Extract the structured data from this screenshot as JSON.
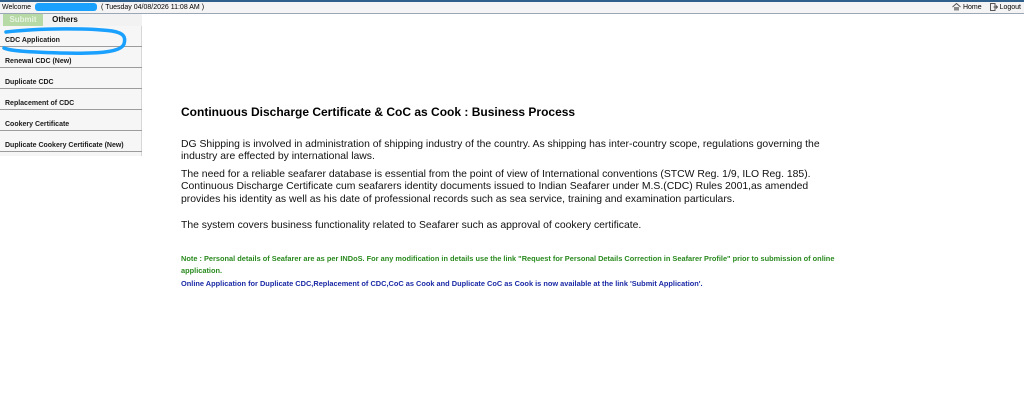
{
  "topbar": {
    "welcome_label": "Welcome",
    "datetime": "( Tuesday 04/08/2026 11:08 AM )",
    "home_label": "Home",
    "logout_label": "Logout"
  },
  "tabs": [
    {
      "label": "Submit",
      "active": true
    },
    {
      "label": "Others",
      "active": false
    }
  ],
  "sidebar": {
    "items": [
      {
        "label": "CDC Application"
      },
      {
        "label": "Renewal CDC (New)"
      },
      {
        "label": "Duplicate CDC"
      },
      {
        "label": "Replacement of CDC"
      },
      {
        "label": "Cookery Certificate"
      },
      {
        "label": "Duplicate Cookery Certificate (New)"
      }
    ]
  },
  "main": {
    "title": "Continuous Discharge Certificate & CoC as Cook : Business Process",
    "paragraphs": [
      "DG Shipping is involved in administration of shipping industry of the country. As shipping has inter-country scope, regulations governing the industry are effected by international laws.",
      "The need for a reliable seafarer database is essential from the point of view of International conventions (STCW Reg. 1/9, ILO Reg. 185). Continuous Discharge Certificate cum seafarers identity documents issued to Indian Seafarer under M.S.(CDC) Rules 2001,as amended provides his identity as well as his date of professional records such as sea service, training and examination particulars.",
      "The system covers business functionality related to Seafarer such as approval of cookery certificate."
    ],
    "note": "Note : Personal details of Seafarer are as per INDoS. For any modification in details use the link \"Request for Personal Details Correction in Seafarer Profile\" prior to submission of online application.",
    "online_notice": "Online Application for Duplicate CDC,Replacement of CDC,CoC as Cook and Duplicate CoC as Cook is now available at the link 'Submit Application'."
  },
  "colors": {
    "active_tab": "#b7d9a6",
    "note_green": "#2a8a1f",
    "notice_blue": "#1b2aa6",
    "highlight_stroke": "#1aa0ff"
  }
}
